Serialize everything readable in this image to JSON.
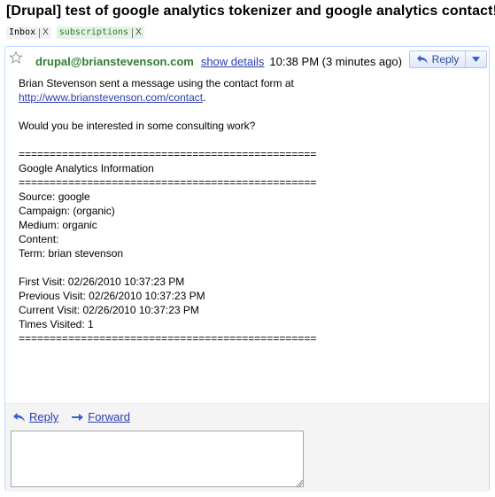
{
  "subject": "[Drupal] test of google analytics tokenizer and google analytics contact!",
  "labels": [
    {
      "name": "Inbox",
      "remove": "X"
    },
    {
      "name": "subscriptions",
      "remove": "X"
    }
  ],
  "message": {
    "sender": "drupal@brianstevenson.com",
    "show_details": "show details",
    "time": "10:38 PM (3 minutes ago)",
    "reply_label": "Reply",
    "body": {
      "intro": "Brian Stevenson sent a message using the contact form at",
      "link": "http://www.brianstevenson.com/contact",
      "link_suffix": ".",
      "question": "Would you be interested in some consulting work?",
      "divider": "================================================",
      "section_title": "Google Analytics Information",
      "source": "Source: google",
      "campaign": "Campaign: (organic)",
      "medium": "Medium: organic",
      "content": "Content:",
      "term": "Term: brian stevenson",
      "first_visit": "First Visit: 02/26/2010 10:37:23 PM",
      "previous_visit": "Previous Visit: 02/26/2010 10:37:23 PM",
      "current_visit": "Current Visit: 02/26/2010 10:37:23 PM",
      "times_visited": "Times Visited: 1"
    }
  },
  "actions": {
    "reply": "Reply",
    "forward": "Forward"
  },
  "colors": {
    "accent_link": "#2a3db0",
    "sender": "#2f7d32",
    "card_border": "#c3d9ff"
  }
}
